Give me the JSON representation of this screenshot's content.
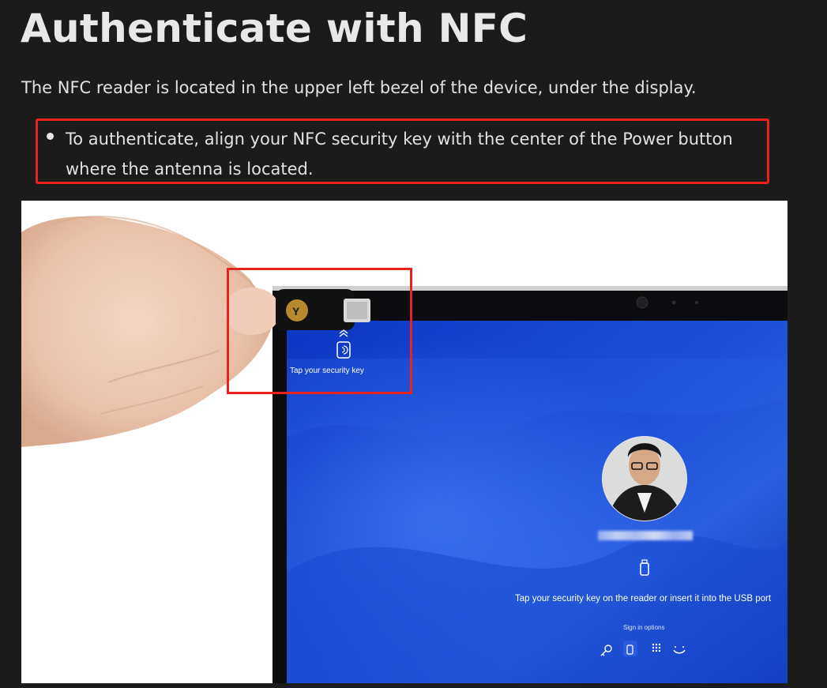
{
  "page": {
    "title": "Authenticate with NFC",
    "intro": "The NFC reader is located in the upper left bezel of the device, under the display.",
    "bullets": [
      "To authenticate, align your NFC security key with the center of the Power button where the antenna is located."
    ]
  },
  "figure": {
    "tap_key_label": "Tap your security key",
    "prompt": "Tap your security key on the reader or insert it into the USB port",
    "sign_in_options": "Sign in options",
    "sign_in_icons": [
      "key-icon",
      "usb-key-icon",
      "pin-keypad-icon",
      "face-icon"
    ],
    "security_key_brand_letter": "Y"
  },
  "colors": {
    "background": "#1b1b1b",
    "highlight": "#e8231d",
    "screen_blue": "#1640c8"
  }
}
